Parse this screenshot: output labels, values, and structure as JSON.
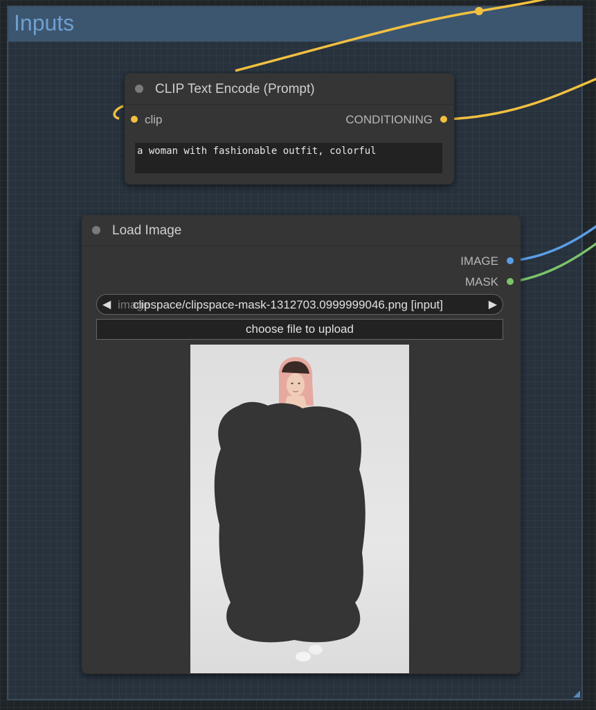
{
  "group": {
    "title": "Inputs"
  },
  "clip_node": {
    "title": "CLIP Text Encode (Prompt)",
    "input_label": "clip",
    "output_label": "CONDITIONING",
    "prompt_text": "a woman with fashionable outfit, colorful"
  },
  "load_image_node": {
    "title": "Load Image",
    "outputs": {
      "image_label": "IMAGE",
      "mask_label": "MASK"
    },
    "image_widget": {
      "name": "image",
      "value": "clipspace/clipspace-mask-1312703.0999999046.png [input]",
      "left_arrow": "◀",
      "right_arrow": "▶"
    },
    "upload_label": "choose file to upload"
  },
  "colors": {
    "clip_wire": "#f2c040",
    "image_wire": "#5a9ee6",
    "mask_wire": "#7cc36a",
    "group_header": "#3c5670",
    "node_bg": "#353535"
  },
  "icons": {
    "node_collapse": "circle-dot-icon",
    "wire_dot": "circle-dot-icon"
  }
}
